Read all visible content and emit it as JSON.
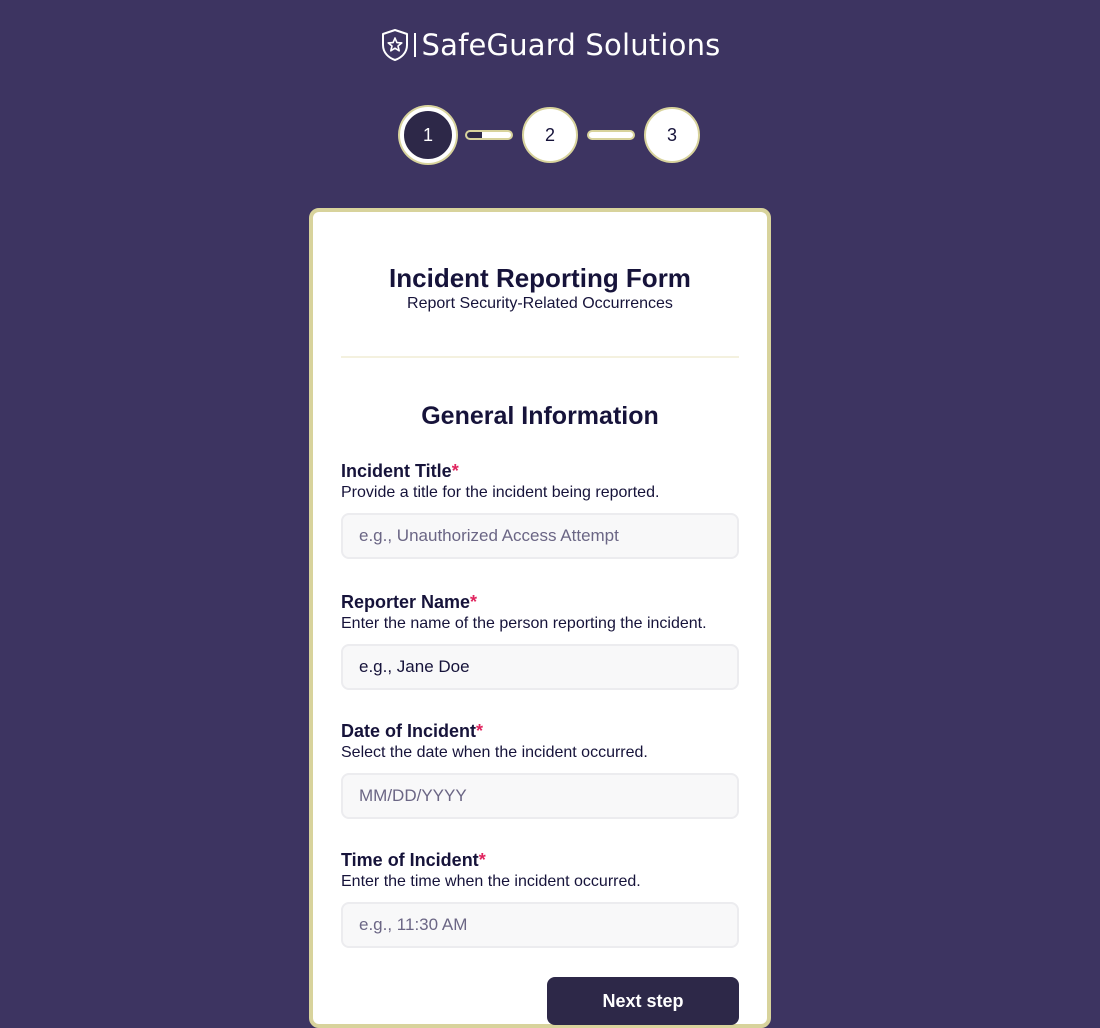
{
  "brand": {
    "name": "SafeGuard Solutions",
    "logo_icon": "shield-star-icon"
  },
  "stepper": {
    "steps": [
      {
        "label": "1",
        "state": "active"
      },
      {
        "label": "2",
        "state": "upcoming"
      },
      {
        "label": "3",
        "state": "upcoming"
      }
    ],
    "connectors": [
      {
        "progress": 0.35
      },
      {
        "progress": 0
      }
    ]
  },
  "form": {
    "title": "Incident Reporting Form",
    "subtitle": "Report Security-Related Occurrences",
    "section_title": "General Information",
    "required_marker": "*",
    "fields": [
      {
        "label": "Incident Title",
        "help": "Provide a title for the incident being reported.",
        "placeholder": "e.g., Unauthorized Access Attempt",
        "value": ""
      },
      {
        "label": "Reporter Name",
        "help": "Enter the name of the person reporting the incident.",
        "placeholder": "e.g., Jane Doe",
        "value": ""
      },
      {
        "label": "Date of Incident",
        "help": "Select the date when the incident occurred.",
        "placeholder": "MM/DD/YYYY",
        "value": ""
      },
      {
        "label": "Time of Incident",
        "help": "Enter the time when the incident occurred.",
        "placeholder": "e.g., 11:30 AM",
        "value": ""
      }
    ],
    "next_label": "Next step"
  },
  "colors": {
    "background": "#3d3461",
    "primary_dark": "#2d2848",
    "accent_border": "#d8d39c",
    "required": "#e0245e",
    "text": "#16133a"
  }
}
